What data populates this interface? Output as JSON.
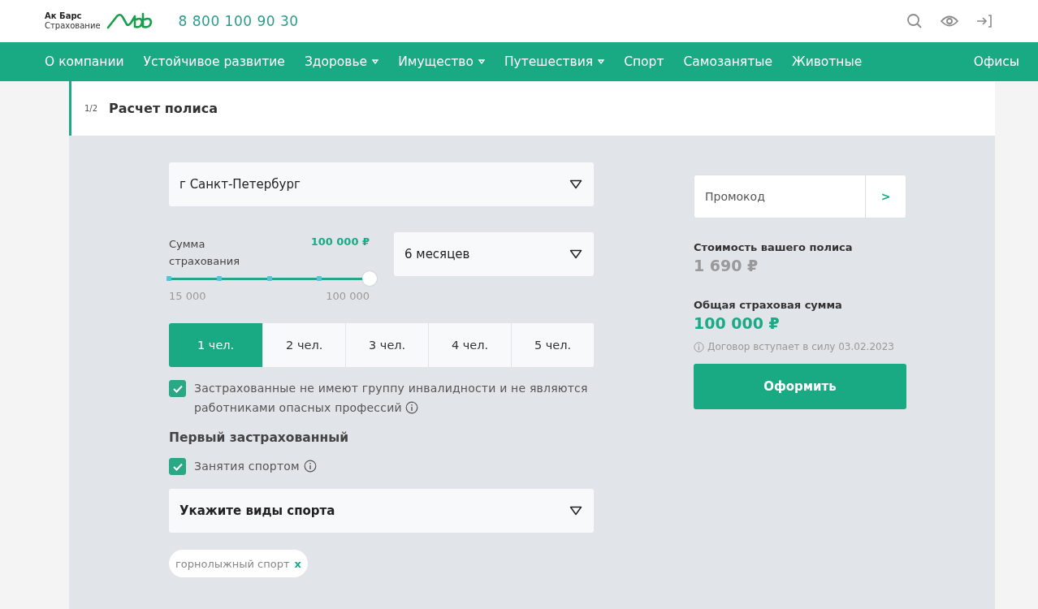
{
  "header": {
    "logo_line1": "Ак Барс",
    "logo_line2": "Страхование",
    "phone": "8 800 100 90 30"
  },
  "nav": {
    "items": [
      {
        "label": "О компании",
        "dropdown": false
      },
      {
        "label": "Устойчивое развитие",
        "dropdown": false
      },
      {
        "label": "Здоровье",
        "dropdown": true
      },
      {
        "label": "Имущество",
        "dropdown": true
      },
      {
        "label": "Путешествия",
        "dropdown": true
      },
      {
        "label": "Спорт",
        "dropdown": false
      },
      {
        "label": "Самозанятые",
        "dropdown": false
      },
      {
        "label": "Животные",
        "dropdown": false
      }
    ],
    "right": "Офисы"
  },
  "step": {
    "counter": "1/2",
    "title": "Расчет полиса"
  },
  "form": {
    "city": "г Санкт-Петербург",
    "sum_label": "Сумма страхования",
    "sum_value": "100 000 ₽",
    "slider": {
      "level": 1,
      "min_label": "15 000",
      "max_label": "100 000"
    },
    "period": "6 месяцев",
    "people": [
      {
        "label": "1 чел.",
        "selected": true
      },
      {
        "label": "2 чел.",
        "selected": false
      },
      {
        "label": "3 чел.",
        "selected": false
      },
      {
        "label": "4 чел.",
        "selected": false
      },
      {
        "label": "5 чел.",
        "selected": false
      }
    ],
    "agreement": {
      "checked": true,
      "text": "Застрахованные не имеют группу инвалидности и не являются работниками опасных профессий"
    },
    "section_title": "Первый застрахованный",
    "sport": {
      "checked": true,
      "text": "Занятия спортом"
    },
    "sport_select": "Укажите виды спорта",
    "tags": [
      {
        "label": "горнолыжный спорт",
        "remove": "x"
      }
    ]
  },
  "summary": {
    "promo_placeholder": "Промокод",
    "promo_button": ">",
    "cost_label": "Стоимость вашего полиса",
    "cost": "1 690 ₽",
    "total_label": "Общая страховая сумма",
    "total": "100 000 ₽",
    "note": "Договор вступает в силу 03.02.2023",
    "submit": "Оформить"
  }
}
